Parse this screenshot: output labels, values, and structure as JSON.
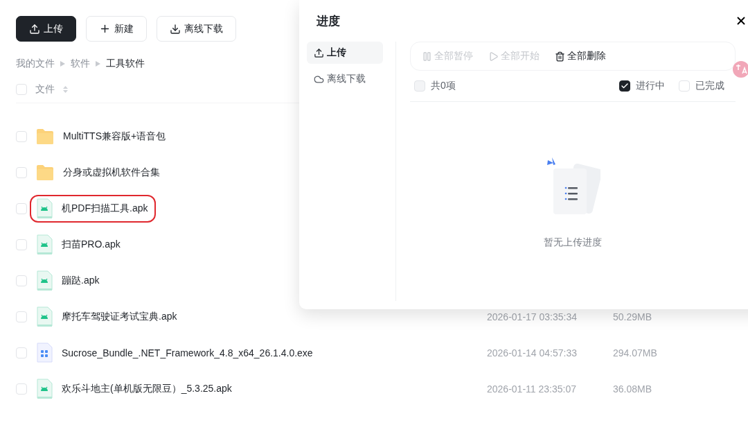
{
  "toolbar": {
    "buttons": [
      {
        "label": "上传",
        "kind": "upload",
        "primary": true
      },
      {
        "label": "新建",
        "kind": "new",
        "primary": false
      },
      {
        "label": "离线下载",
        "kind": "download",
        "primary": false
      }
    ]
  },
  "breadcrumb": [
    "我的文件",
    "软件",
    "工具软件"
  ],
  "file_list": {
    "header": {
      "label": "文件",
      "checked": false
    },
    "rows": [
      {
        "name": "MultiTTS兼容版+语音包",
        "kind": "folder",
        "checked": false,
        "highlighted": false
      },
      {
        "name": "分身或虚拟机软件合集",
        "kind": "folder",
        "checked": false,
        "highlighted": false
      },
      {
        "name": "机PDF扫描工具.apk",
        "kind": "android",
        "checked": false,
        "highlighted": true
      },
      {
        "name": "扫苗PRO.apk",
        "kind": "android",
        "checked": false,
        "highlighted": false
      },
      {
        "name": "蹦跶.apk",
        "kind": "android",
        "checked": false,
        "highlighted": false
      },
      {
        "name": "摩托车驾驶证考试宝典.apk",
        "kind": "android",
        "checked": false,
        "highlighted": false,
        "modified": "2026-01-17 03:35:34",
        "size": "50.29MB"
      },
      {
        "name": "Sucrose_Bundle_.NET_Framework_4.8_x64_26.1.4.0.exe",
        "kind": "program",
        "checked": false,
        "highlighted": false,
        "modified": "2026-01-14 04:57:33",
        "size": "294.07MB"
      },
      {
        "name": "欢乐斗地主(单机版无限豆）_5.3.25.apk",
        "kind": "android",
        "checked": false,
        "highlighted": false,
        "modified": "2026-01-11 23:35:07",
        "size": "36.08MB"
      }
    ]
  },
  "progress_panel": {
    "title": "进度",
    "tabs": [
      {
        "label": "上传",
        "kind": "upload",
        "selected": true
      },
      {
        "label": "离线下载",
        "kind": "cloud",
        "selected": false
      }
    ],
    "actions": [
      {
        "label": "全部暂停",
        "kind": "pause",
        "disabled": true
      },
      {
        "label": "全部开始",
        "kind": "play",
        "disabled": true
      },
      {
        "label": "全部删除",
        "kind": "delete",
        "disabled": false
      }
    ],
    "select_all": {
      "label": "共0项",
      "checked": false
    },
    "filters": [
      {
        "label": "进行中",
        "checked": true
      },
      {
        "label": "已完成",
        "checked": false
      }
    ],
    "empty_text": "暂无上传进度"
  }
}
